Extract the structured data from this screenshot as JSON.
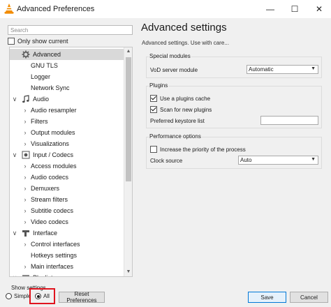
{
  "window": {
    "title": "Advanced Preferences",
    "min_glyph": "—",
    "max_glyph": "☐",
    "close_glyph": "✕"
  },
  "sidebar": {
    "search_placeholder": "Search",
    "only_current_label": "Only show current",
    "only_current_checked": false,
    "tree": [
      {
        "label": "Advanced",
        "level": "category",
        "icon": "gear-icon",
        "chevron": "none",
        "selected": true
      },
      {
        "label": "GNU TLS",
        "level": "leaf"
      },
      {
        "label": "Logger",
        "level": "leaf"
      },
      {
        "label": "Network Sync",
        "level": "leaf"
      },
      {
        "label": "Audio",
        "level": "category",
        "icon": "music-note-icon",
        "chevron": "down"
      },
      {
        "label": "Audio resampler",
        "level": "sub",
        "chevron": "right"
      },
      {
        "label": "Filters",
        "level": "sub",
        "chevron": "right"
      },
      {
        "label": "Output modules",
        "level": "sub",
        "chevron": "right"
      },
      {
        "label": "Visualizations",
        "level": "sub",
        "chevron": "right"
      },
      {
        "label": "Input / Codecs",
        "level": "category",
        "icon": "codec-icon",
        "chevron": "down"
      },
      {
        "label": "Access modules",
        "level": "sub",
        "chevron": "right"
      },
      {
        "label": "Audio codecs",
        "level": "sub",
        "chevron": "right"
      },
      {
        "label": "Demuxers",
        "level": "sub",
        "chevron": "right"
      },
      {
        "label": "Stream filters",
        "level": "sub",
        "chevron": "right"
      },
      {
        "label": "Subtitle codecs",
        "level": "sub",
        "chevron": "right"
      },
      {
        "label": "Video codecs",
        "level": "sub",
        "chevron": "right"
      },
      {
        "label": "Interface",
        "level": "category",
        "icon": "interface-icon",
        "chevron": "down"
      },
      {
        "label": "Control interfaces",
        "level": "sub",
        "chevron": "right"
      },
      {
        "label": "Hotkeys settings",
        "level": "leaf"
      },
      {
        "label": "Main interfaces",
        "level": "sub",
        "chevron": "right"
      },
      {
        "label": "Playlist",
        "level": "category",
        "icon": "playlist-icon",
        "chevron": "down"
      }
    ]
  },
  "panel": {
    "title": "Advanced settings",
    "subtitle": "Advanced settings. Use with care...",
    "sections": {
      "special_modules": {
        "title": "Special modules",
        "vod_label": "VoD server module",
        "vod_value": "Automatic"
      },
      "plugins": {
        "title": "Plugins",
        "use_cache_label": "Use a plugins cache",
        "use_cache_checked": true,
        "scan_label": "Scan for new plugins",
        "scan_checked": true,
        "keystore_label": "Preferred keystore list",
        "keystore_value": ""
      },
      "performance": {
        "title": "Performance options",
        "priority_label": "Increase the priority of the process",
        "priority_checked": false,
        "clock_label": "Clock source",
        "clock_value": "Auto"
      }
    }
  },
  "footer": {
    "show_settings_label": "Show settings",
    "simple_label": "Simple",
    "all_label": "All",
    "selected_mode": "All",
    "reset_label": "Reset Preferences",
    "save_label": "Save",
    "cancel_label": "Cancel",
    "highlight_color": "#e0141e"
  },
  "colors": {
    "accent": "#0078d7",
    "vlc_orange": "#f28c00",
    "selection": "#d9d9d9"
  }
}
